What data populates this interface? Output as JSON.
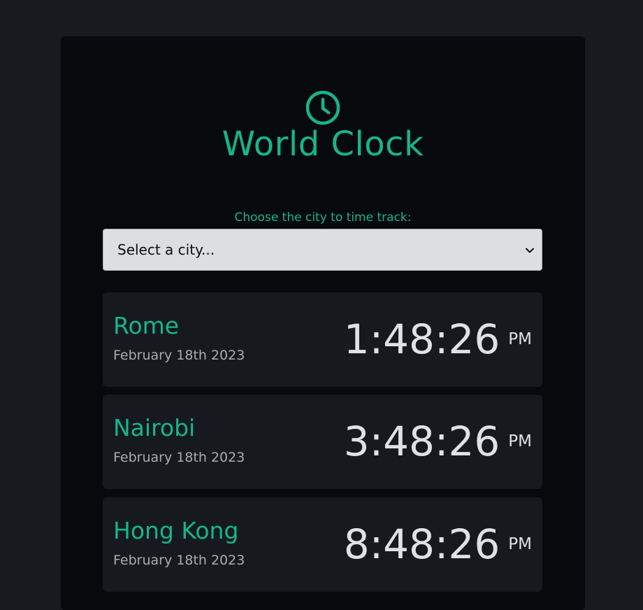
{
  "app": {
    "title": "World Clock",
    "accent_color": "#16b58d",
    "icon": "clock-icon"
  },
  "selector": {
    "label": "Choose the city to time track:",
    "selected": "Select a city..."
  },
  "cities": [
    {
      "name": "Rome",
      "date": "February 18th 2023",
      "time": "1:48:26",
      "ampm": "PM"
    },
    {
      "name": "Nairobi",
      "date": "February 18th 2023",
      "time": "3:48:26",
      "ampm": "PM"
    },
    {
      "name": "Hong Kong",
      "date": "February 18th 2023",
      "time": "8:48:26",
      "ampm": "PM"
    }
  ]
}
